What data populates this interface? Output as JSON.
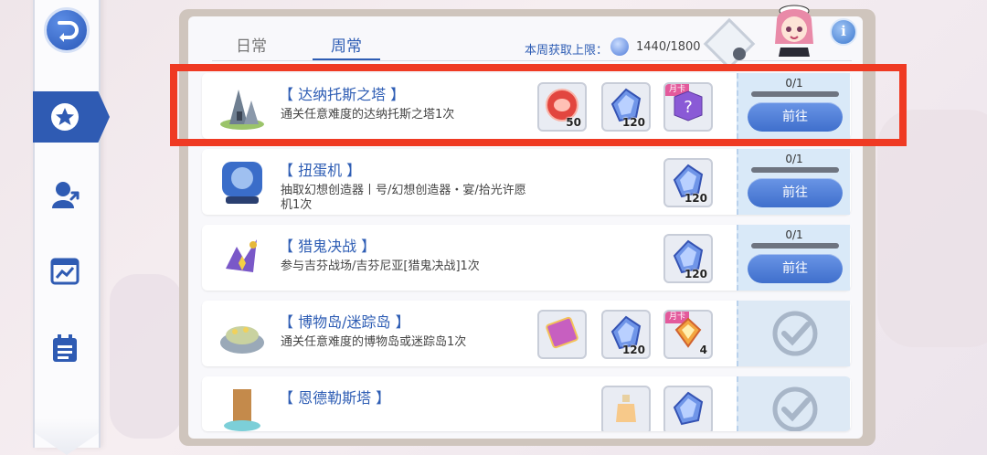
{
  "tabs": {
    "daily": "日常",
    "weekly": "周常",
    "active": "weekly"
  },
  "weekly_limit": {
    "label": "本周获取上限：",
    "value": "1440/1800"
  },
  "nav": {
    "items": [
      "back",
      "missions",
      "character-upgrade",
      "stats",
      "calendar"
    ],
    "active": "missions"
  },
  "colors": {
    "accent": "#2e5db4",
    "highlight": "#ef3a23",
    "progress": "#f2b33d"
  },
  "missions": [
    {
      "title": "【 达纳托斯之塔 】",
      "desc": "通关任意难度的达纳托斯之塔1次",
      "rewards": [
        {
          "icon": "red-coin-icon",
          "count": "50"
        },
        {
          "icon": "blue-crystal-icon",
          "count": "120"
        },
        {
          "icon": "mystery-box-icon",
          "count": "",
          "badge": "月卡"
        }
      ],
      "progress": "0/1",
      "progress_value": 0,
      "action": "前往",
      "status": "go"
    },
    {
      "title": "【 扭蛋机 】",
      "desc": "抽取幻想创造器丨号/幻想创造器・宴/拾光许愿机1次",
      "rewards": [
        {
          "icon": "blue-crystal-icon",
          "count": "120"
        }
      ],
      "progress": "0/1",
      "progress_value": 0,
      "action": "前往",
      "status": "go"
    },
    {
      "title": "【 猎鬼决战 】",
      "desc": "参与吉芬战场/吉芬尼亚[猎鬼决战]1次",
      "rewards": [
        {
          "icon": "blue-crystal-icon",
          "count": "120"
        }
      ],
      "progress": "0/1",
      "progress_value": 0,
      "action": "前往",
      "status": "go"
    },
    {
      "title": "【 博物岛/迷踪岛 】",
      "desc": "通关任意难度的博物岛或迷踪岛1次",
      "rewards": [
        {
          "icon": "card-icon",
          "count": ""
        },
        {
          "icon": "blue-crystal-icon",
          "count": "120"
        },
        {
          "icon": "orange-gem-icon",
          "count": "4",
          "badge": "月卡"
        }
      ],
      "status": "done"
    },
    {
      "title": "【 恩德勒斯塔 】",
      "desc": "",
      "rewards": [
        {
          "icon": "potion-icon",
          "count": ""
        },
        {
          "icon": "blue-crystal-icon",
          "count": ""
        }
      ],
      "status": "done"
    }
  ]
}
